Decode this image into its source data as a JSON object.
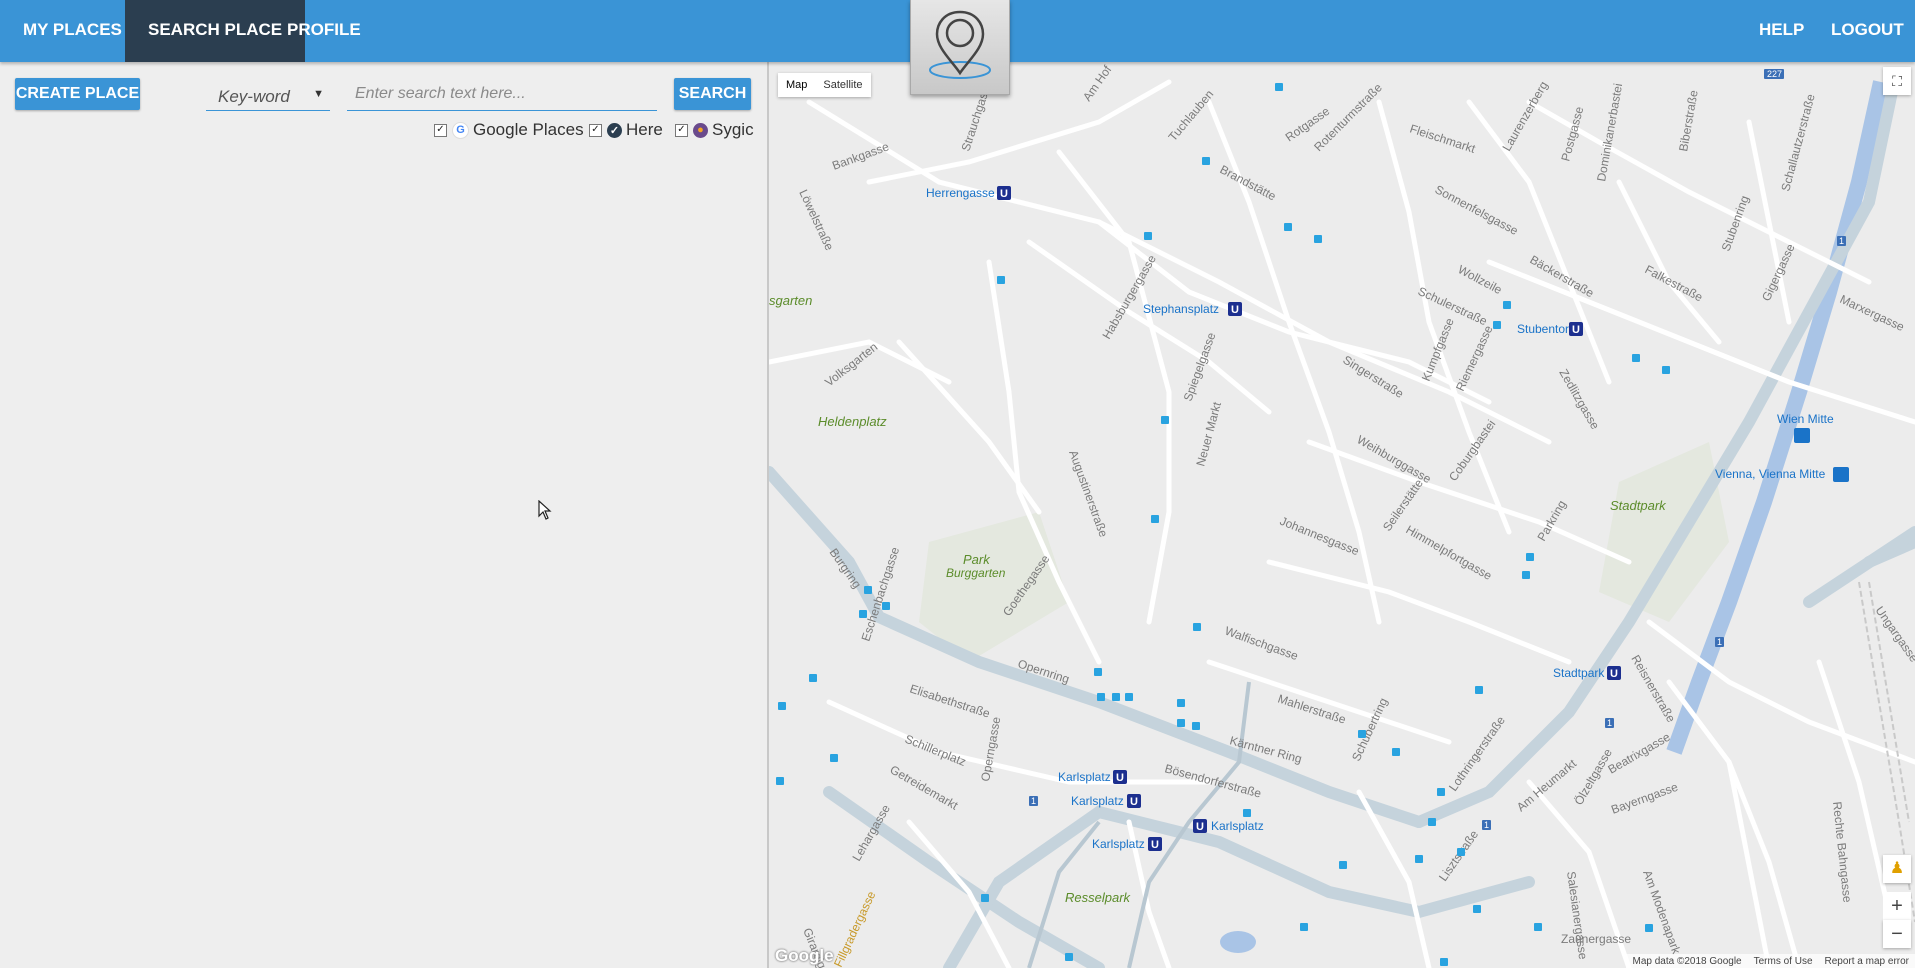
{
  "nav": {
    "items": [
      {
        "label": "MY PLACES"
      },
      {
        "label": "SEARCH PLACE",
        "active": true
      },
      {
        "label": "PROFILE"
      }
    ],
    "right_items": [
      {
        "label": "HELP"
      },
      {
        "label": "LOGOUT"
      }
    ],
    "logo_icon": "map-pin-icon",
    "colors": {
      "bar": "#3a94d6",
      "active": "#2b3e50"
    }
  },
  "panel": {
    "create_button": "CREATE PLACE",
    "search_mode": {
      "selected": "Key-word"
    },
    "search_input": {
      "value": "",
      "placeholder": "Enter search text here..."
    },
    "search_button": "SEARCH",
    "sources": [
      {
        "label": "Google Places",
        "checked": true,
        "icon": "google-icon"
      },
      {
        "label": "Here",
        "checked": true,
        "icon": "here-icon"
      },
      {
        "label": "Sygic",
        "checked": true,
        "icon": "sygic-icon"
      }
    ]
  },
  "map": {
    "type_control": {
      "map": "Map",
      "satellite": "Satellite"
    },
    "zoom": {
      "in": "+",
      "out": "−"
    },
    "attribution": {
      "logo": "Google",
      "data": "Map data ©2018 Google",
      "terms": "Terms of Use",
      "report": "Report a map error"
    },
    "streets": [
      "Bankgasse",
      "Strauchgasse",
      "Am Hof",
      "Tuchlauben",
      "Brandstätte",
      "Rotgasse",
      "Rotenturmstraße",
      "Fleischmarkt",
      "Laurenzerberg",
      "Postgasse",
      "Dominikanerbastei",
      "Biberstraße",
      "Schallautzerstraße",
      "Löwelstraße",
      "Sonnenfelsgasse",
      "Bäckerstraße",
      "Wollzeile",
      "Schulerstraße",
      "Falkestraße",
      "Stubenring",
      "Marxergasse",
      "Habsburgergasse",
      "Spiegelgasse",
      "Singerstraße",
      "Kumpfgasse",
      "Riemergasse",
      "Zedlitzgasse",
      "Gigergasse",
      "Volksgarten",
      "Neuer Markt",
      "Weihburggasse",
      "Coburgbastei",
      "Augustinerstraße",
      "Seilerstätte",
      "Himmelpfortgasse",
      "Parkring",
      "Burgring",
      "Goethegasse",
      "Johannesgasse",
      "Walfischgasse",
      "Mahlerstraße",
      "Opernring",
      "Elisabethstraße",
      "Eschenbachgasse",
      "Schillerplatz",
      "Operngasse",
      "Kärntner Ring",
      "Bösendorferstraße",
      "Schubertring",
      "Lothringerstraße",
      "Am Heumarkt",
      "Reisnerstraße",
      "Beatrixgasse",
      "Getreidemarkt",
      "Lehargasse",
      "Lisztstraße",
      "Bayerngasse",
      "Zaunergasse",
      "Am Modenapark",
      "Salesianergasse",
      "Ölzeltgasse",
      "Rechte Bahngasse",
      "Ungargasse",
      "Girardigasse",
      "Fillgradergasse"
    ],
    "places": [
      "Herrengasse",
      "Stephansplatz",
      "Stubentor",
      "Wien Mitte",
      "Vienna, Vienna Mitte",
      "Stadtpark",
      "Karlsplatz",
      "Karlsplatz",
      "Karlsplatz",
      "Karlsplatz"
    ],
    "parks": [
      "Heldenplatz",
      "Park",
      "Burggarten",
      "Stadtpark",
      "Resselpark",
      "sgarten"
    ],
    "route_shields": [
      "1",
      "1",
      "1",
      "1",
      "1",
      "227"
    ],
    "subway_badge": "U",
    "colors": {
      "background": "#ececec",
      "road": "#ffffff",
      "ring_road": "#c5d3dc",
      "water": "#a9c4e6",
      "park_label": "#5b8c2a",
      "transit_label": "#1a73c8",
      "subway": "#1c2f8f"
    }
  },
  "cursor_icon": "pointer-cursor-icon"
}
